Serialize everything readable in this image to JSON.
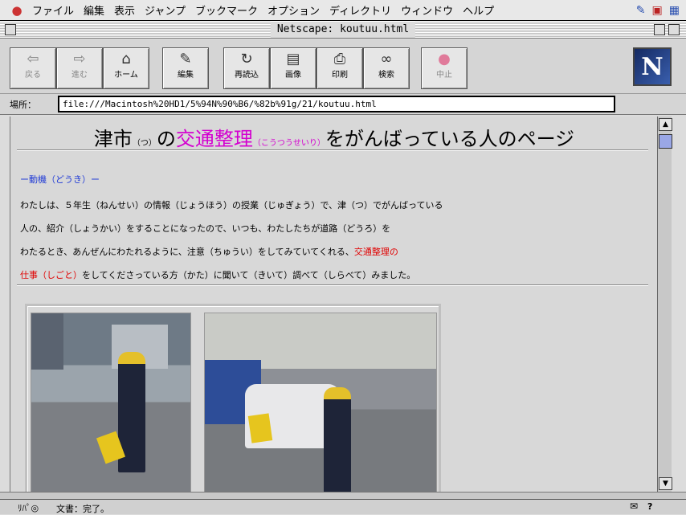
{
  "menubar": {
    "apple": "",
    "items": [
      "ファイル",
      "編集",
      "表示",
      "ジャンプ",
      "ブックマーク",
      "オプション",
      "ディレクトリ",
      "ウィンドウ",
      "ヘルプ"
    ]
  },
  "window": {
    "title": "Netscape: koutuu.html"
  },
  "toolbar": {
    "buttons": [
      {
        "label": "戻る",
        "icon": "back-arrow-icon"
      },
      {
        "label": "進む",
        "icon": "forward-arrow-icon"
      },
      {
        "label": "ホーム",
        "icon": "home-icon"
      },
      {
        "label": "編集",
        "icon": "pencil-icon"
      },
      {
        "label": "再読込",
        "icon": "reload-icon"
      },
      {
        "label": "画像",
        "icon": "images-icon"
      },
      {
        "label": "印刷",
        "icon": "printer-icon"
      },
      {
        "label": "検索",
        "icon": "binoculars-icon"
      },
      {
        "label": "中止",
        "icon": "stop-icon"
      }
    ],
    "logo": "N"
  },
  "location": {
    "label": "場所：",
    "url": "file:///Macintosh%20HD1/5%94N%90%B6/%82b%91g/21/koutuu.html"
  },
  "page": {
    "heading": {
      "part1": "津市",
      "ruby1": "（つ）",
      "part2": "の",
      "part3": "交通整理",
      "ruby3": "（こうつうせいり）",
      "part4": "をがんばっている人のページ"
    },
    "section_label": "ー動機（どうき）ー",
    "lines": [
      "わたしは、５年生（ねんせい）の情報（じょうほう）の授業（じゅぎょう）で、津（つ）でがんばっている",
      "人の、紹介（しょうかい）をすることになったので、いつも、わたしたちが道路（どうろ）を",
      "わたるとき、あんぜんにわたれるように、注意（ちゅうい）をしてみていてくれる、"
    ],
    "line3_red": "交通整理の",
    "line4_red": "仕事（しごと）",
    "line4_rest": "をしてくださっている方（かた）に聞いて（きいて）調べて（しらべて）みました。"
  },
  "status": {
    "text": "文書：完了。",
    "icons": "ﾘﾊﾟ◎"
  },
  "colors": {
    "link_blue": "#1f3ad6",
    "heading_magenta": "#d400d0",
    "highlight_red": "#e00000",
    "netscape_blue": "#2b4a9b"
  }
}
